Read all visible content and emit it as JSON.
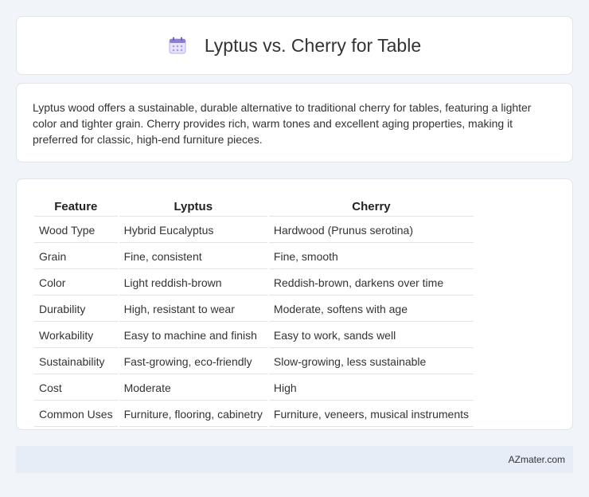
{
  "header": {
    "title": "Lyptus vs. Cherry for Table",
    "icon": "calendar-icon"
  },
  "summary": {
    "text": "Lyptus wood offers a sustainable, durable alternative to traditional cherry for tables, featuring a lighter color and tighter grain. Cherry provides rich, warm tones and excellent aging properties, making it preferred for classic, high-end furniture pieces."
  },
  "table": {
    "headers": [
      "Feature",
      "Lyptus",
      "Cherry"
    ],
    "rows": [
      [
        "Wood Type",
        "Hybrid Eucalyptus",
        "Hardwood (Prunus serotina)"
      ],
      [
        "Grain",
        "Fine, consistent",
        "Fine, smooth"
      ],
      [
        "Color",
        "Light reddish-brown",
        "Reddish-brown, darkens over time"
      ],
      [
        "Durability",
        "High, resistant to wear",
        "Moderate, softens with age"
      ],
      [
        "Workability",
        "Easy to machine and finish",
        "Easy to work, sands well"
      ],
      [
        "Sustainability",
        "Fast-growing, eco-friendly",
        "Slow-growing, less sustainable"
      ],
      [
        "Cost",
        "Moderate",
        "High"
      ],
      [
        "Common Uses",
        "Furniture, flooring, cabinetry",
        "Furniture, veneers, musical instruments"
      ]
    ]
  },
  "footer": {
    "brand": "AZmater.com"
  },
  "colors": {
    "page_bg": "#f1f4f9",
    "card_bg": "#ffffff",
    "footer_bg": "#e7edf7",
    "icon_accent": "#8b7fd6"
  }
}
